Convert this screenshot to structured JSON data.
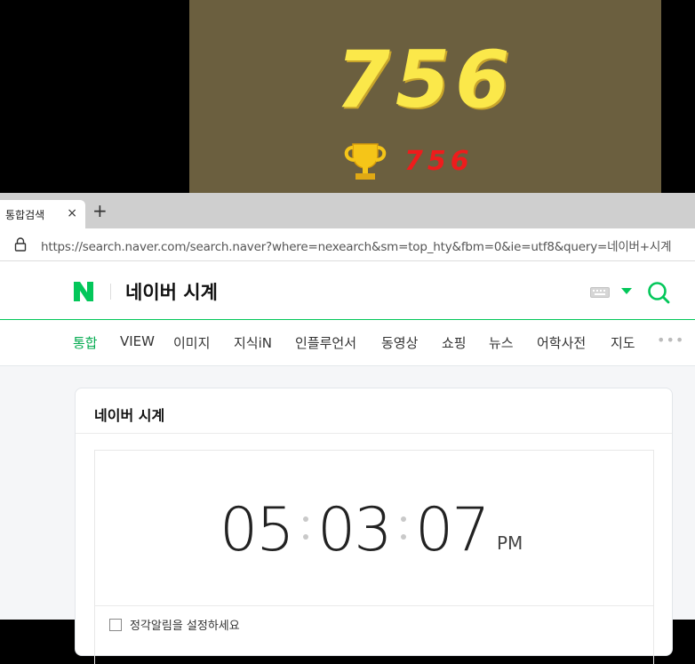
{
  "game": {
    "score": "756",
    "best_score": "756",
    "panel_color": "#6b5f3f",
    "score_color": "#fbe84a",
    "best_color": "#ee1c1c",
    "trophy_icon": "trophy-icon"
  },
  "browser": {
    "tab_title": "통합검색",
    "tab_close": "×",
    "new_tab": "+",
    "url": "https://search.naver.com/search.naver?where=nexearch&sm=top_hty&fbm=0&ie=utf8&query=네이버+시계"
  },
  "naver": {
    "logo": "N",
    "brand_color": "#03c75a",
    "query": "네이버 시계",
    "nav": [
      "통합",
      "VIEW",
      "이미지",
      "지식iN",
      "인플루언서",
      "동영상",
      "쇼핑",
      "뉴스",
      "어학사전",
      "지도"
    ],
    "nav_more": "•••",
    "card_title": "네이버 시계",
    "clock": {
      "hours": "05",
      "minutes": "03",
      "seconds": "07",
      "ampm": "PM"
    },
    "alarm_label": "정각알림을 설정하세요"
  }
}
